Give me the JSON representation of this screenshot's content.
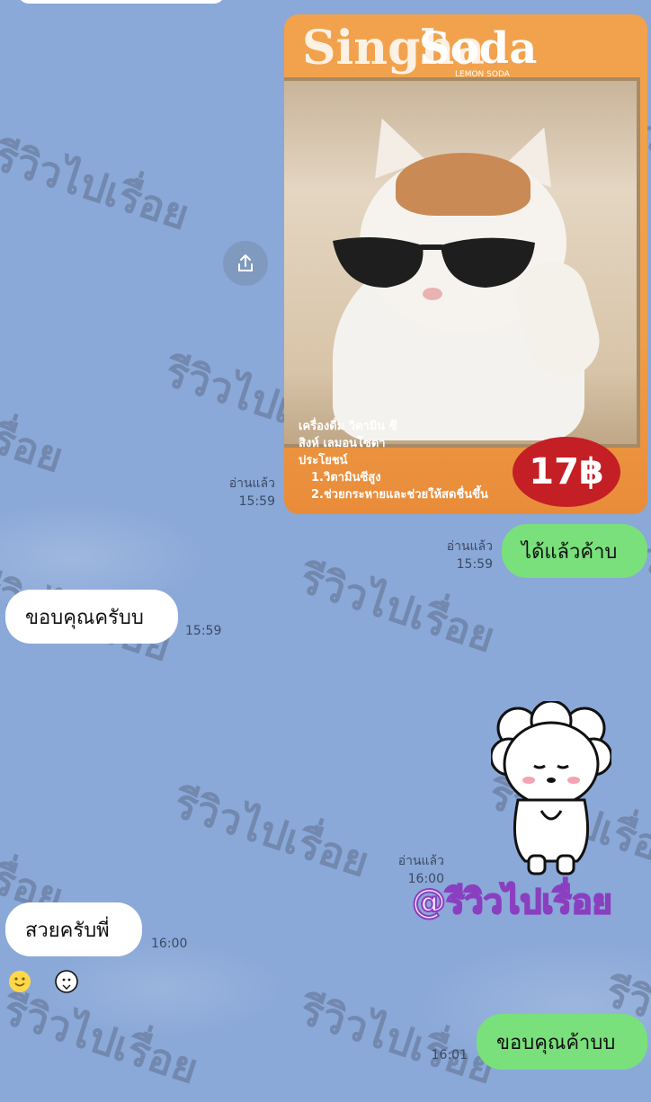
{
  "watermark_text": "รีวิวไปเรื่อย",
  "photo": {
    "brand_text": "Soda",
    "brand_top": "Singha",
    "sub_label": "LEMON SODA",
    "price": "17฿",
    "caption_lines": [
      "เครื่องดื่ม วิตามิน ซี",
      "สิงห์ เลมอนโซดา",
      "ประโยชน์",
      "1.วิตามินซีสูง",
      "2.ช่วยกระหายและช่วยให้สดชื่นขึ้น"
    ],
    "read_label": "อ่านแล้ว",
    "time": "15:59"
  },
  "messages": [
    {
      "side": "right",
      "text": "ได้แล้วค้าบ",
      "read": "อ่านแล้ว",
      "time": "15:59"
    },
    {
      "side": "left",
      "text": "ขอบคุณครับบ",
      "time": "15:59"
    },
    {
      "side": "sticker",
      "read": "อ่านแล้ว",
      "time": "16:00",
      "caption": "@รีวิวไปเรื่อย"
    },
    {
      "side": "left",
      "text": "สวยครับพี่",
      "time": "16:00"
    },
    {
      "side": "right",
      "text": "ขอบคุณค้าบบ",
      "time": "16:01"
    }
  ],
  "icons": {
    "share": "share-icon",
    "smile": "smile-emoji-icon",
    "sticker_small": "bear-sticker-icon"
  },
  "colors": {
    "chat_bg": "#8aa8d8",
    "bubble_left": "#ffffff",
    "bubble_right": "#79e07c"
  }
}
